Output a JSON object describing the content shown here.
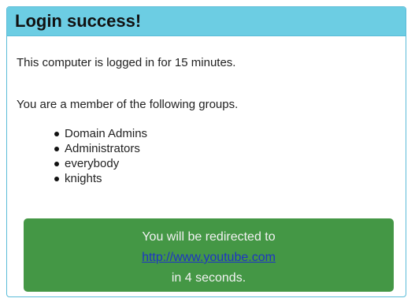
{
  "header": {
    "title": "Login success!"
  },
  "message": {
    "logged_in": "This computer is logged in for 15 minutes.",
    "groups_intro": "You are a member of the following groups."
  },
  "groups": [
    "Domain Admins",
    "Administrators",
    "everybody",
    "knights"
  ],
  "redirect": {
    "prefix": "You will be redirected to",
    "url": "http://www.youtube.com",
    "suffix": "in 4 seconds."
  },
  "colors": {
    "header_bg": "#6ccde3",
    "border": "#5bbcd8",
    "redirect_bg": "#449745",
    "link": "#1e35c4"
  }
}
